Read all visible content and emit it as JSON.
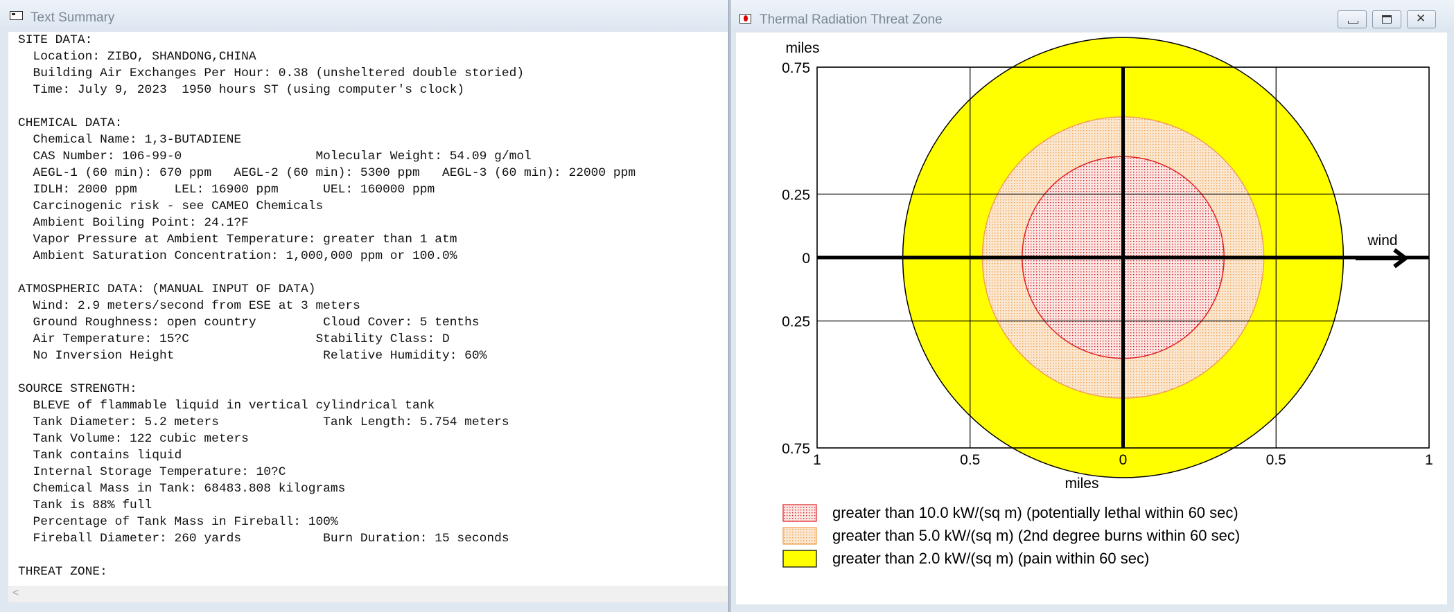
{
  "left_window": {
    "title": "Text Summary",
    "summary_text": "SITE DATA:\n  Location: ZIBO, SHANDONG,CHINA\n  Building Air Exchanges Per Hour: 0.38 (unsheltered double storied)\n  Time: July 9, 2023  1950 hours ST (using computer's clock)\n\nCHEMICAL DATA:\n  Chemical Name: 1,3-BUTADIENE\n  CAS Number: 106-99-0                  Molecular Weight: 54.09 g/mol\n  AEGL-1 (60 min): 670 ppm   AEGL-2 (60 min): 5300 ppm   AEGL-3 (60 min): 22000 ppm\n  IDLH: 2000 ppm     LEL: 16900 ppm      UEL: 160000 ppm\n  Carcinogenic risk - see CAMEO Chemicals\n  Ambient Boiling Point: 24.1?F\n  Vapor Pressure at Ambient Temperature: greater than 1 atm\n  Ambient Saturation Concentration: 1,000,000 ppm or 100.0%\n\nATMOSPHERIC DATA: (MANUAL INPUT OF DATA)\n  Wind: 2.9 meters/second from ESE at 3 meters\n  Ground Roughness: open country         Cloud Cover: 5 tenths\n  Air Temperature: 15?C                 Stability Class: D\n  No Inversion Height                    Relative Humidity: 60%\n\nSOURCE STRENGTH:\n  BLEVE of flammable liquid in vertical cylindrical tank\n  Tank Diameter: 5.2 meters              Tank Length: 5.754 meters\n  Tank Volume: 122 cubic meters\n  Tank contains liquid\n  Internal Storage Temperature: 10?C\n  Chemical Mass in Tank: 68483.808 kilograms\n  Tank is 88% full\n  Percentage of Tank Mass in Fireball: 100%\n  Fireball Diameter: 260 yards           Burn Duration: 15 seconds\n\nTHREAT ZONE:",
    "scroll_arrow": "<"
  },
  "right_window": {
    "title": "Thermal Radiation Threat Zone",
    "wind_label": "wind",
    "legend": [
      {
        "label": "greater than 10.0 kW/(sq m) (potentially lethal within 60 sec)",
        "fill": "#fbe6e4",
        "stroke": "#e02020",
        "pattern": "dotted-red"
      },
      {
        "label": "greater than 5.0 kW/(sq m) (2nd degree burns within 60 sec)",
        "fill": "#fbe6cf",
        "stroke": "#f0a050",
        "pattern": "dotted-orange"
      },
      {
        "label": "greater than 2.0 kW/(sq m) (pain within 60 sec)",
        "fill": "#ffff00",
        "stroke": "#000000",
        "pattern": "solid"
      }
    ]
  },
  "chart_data": {
    "type": "threat-zone-plot",
    "xlabel": "miles",
    "ylabel": "miles",
    "xlim": [
      -1,
      1
    ],
    "ylim": [
      -0.75,
      0.75
    ],
    "x_ticks": [
      {
        "value": -1,
        "label": "1"
      },
      {
        "value": -0.5,
        "label": "0.5"
      },
      {
        "value": 0,
        "label": "0"
      },
      {
        "value": 0.5,
        "label": "0.5"
      },
      {
        "value": 1,
        "label": "1"
      }
    ],
    "y_ticks": [
      {
        "value": 0.75,
        "label": "0.75"
      },
      {
        "value": 0.25,
        "label": "0.25"
      },
      {
        "value": 0,
        "label": "0"
      },
      {
        "value": -0.25,
        "label": "0.25"
      },
      {
        "value": -0.75,
        "label": "0.75"
      }
    ],
    "grid": true,
    "zones": [
      {
        "name": "yellow",
        "radius_miles": 0.72,
        "fill": "#ffff00",
        "stroke": "#000000",
        "pattern": "solid"
      },
      {
        "name": "orange",
        "radius_miles": 0.46,
        "fill": "#fbe6cf",
        "stroke": "#f0a050",
        "pattern": "dotted-orange"
      },
      {
        "name": "red",
        "radius_miles": 0.33,
        "fill": "#fbe6e4",
        "stroke": "#e02020",
        "pattern": "dotted-red"
      }
    ]
  }
}
